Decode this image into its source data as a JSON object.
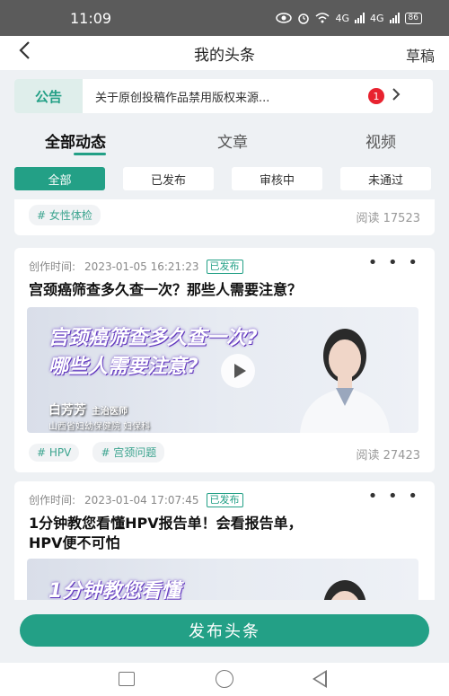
{
  "status_bar": {
    "time": "11:09",
    "network_1": "4G",
    "network_2": "4G",
    "battery": "86"
  },
  "header": {
    "back_icon": "chevron-left-icon",
    "title": "我的头条",
    "draft_label": "草稿"
  },
  "notice": {
    "tag": "公告",
    "text": "关于原创投稿作品禁用版权来源...",
    "badge_count": "1"
  },
  "tabs": [
    {
      "label": "全部动态",
      "active": true
    },
    {
      "label": "文章"
    },
    {
      "label": "视频"
    }
  ],
  "filters": [
    {
      "label": "全部",
      "active": true
    },
    {
      "label": "已发布"
    },
    {
      "label": "审核中"
    },
    {
      "label": "未通过"
    }
  ],
  "posts": [
    {
      "tags": [
        "# 女性体检"
      ],
      "reads": "阅读 17523"
    },
    {
      "created_label": "创作时间:",
      "created_time": "2023-01-05 16:21:23",
      "status": "已发布",
      "title": "宫颈癌筛查多久查一次？那些人需要注意？",
      "thumb": {
        "line1": "宫颈癌筛查多久查一次?",
        "line2": "哪些人需要注意?",
        "author": "白芳芳",
        "role": "主治医师",
        "hospital": "山西省妇幼保健院 妇保科"
      },
      "tags": [
        "# HPV",
        "# 宫颈问题"
      ],
      "reads": "阅读 27423"
    },
    {
      "created_label": "创作时间:",
      "created_time": "2023-01-04 17:07:45",
      "status": "已发布",
      "title_line1": "1分钟教您看懂HPV报告单！会看报告单，",
      "title_line2": "HPV便不可怕",
      "thumb": {
        "line1": "1分钟教您看懂"
      }
    }
  ],
  "publish_button": "发布头条",
  "colors": {
    "accent": "#23a086",
    "badge": "#e8222f",
    "statusbar": "#5b5b5b"
  }
}
